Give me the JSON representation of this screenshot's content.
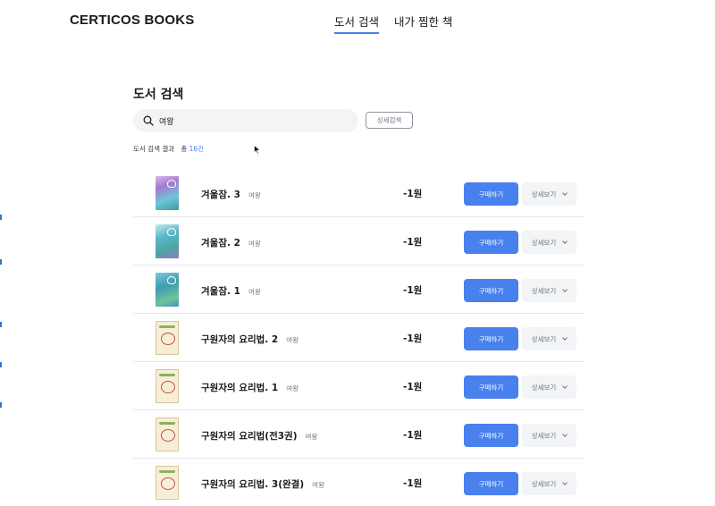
{
  "header": {
    "logo": "CERTICOS BOOKS",
    "nav": [
      {
        "label": "도서 검색",
        "active": true
      },
      {
        "label": "내가 찜한 책",
        "active": false
      }
    ]
  },
  "search": {
    "title": "도서 검색",
    "query": "여왕",
    "detail_button": "상세검색"
  },
  "results": {
    "label": "도서 검색 결과",
    "total_prefix": "총",
    "count": "16",
    "count_suffix": "건"
  },
  "books": [
    {
      "title": "겨울잠. 3",
      "author": "여왕",
      "price": "-1원",
      "cover": "winter-cover-icon"
    },
    {
      "title": "겨울잠. 2",
      "author": "여왕",
      "price": "-1원",
      "cover": "winter-cover-icon"
    },
    {
      "title": "겨울잠. 1",
      "author": "여왕",
      "price": "-1원",
      "cover": "winter-cover-icon"
    },
    {
      "title": "구원자의 요리법. 2",
      "author": "여왕",
      "price": "-1원",
      "cover": "cookbook-cover-icon"
    },
    {
      "title": "구원자의 요리법. 1",
      "author": "여왕",
      "price": "-1원",
      "cover": "cookbook-cover-icon"
    },
    {
      "title": "구원자의 요리법(전3권)",
      "author": "여왕",
      "price": "-1원",
      "cover": "cookbook-cover-icon"
    },
    {
      "title": "구원자의 요리법. 3(완결)",
      "author": "여왕",
      "price": "-1원",
      "cover": "cookbook-cover-icon"
    }
  ],
  "buttons": {
    "buy": "구매하기",
    "detail": "상세보기"
  },
  "colors": {
    "accent": "#4880ee",
    "search_bg": "#f2f4f6",
    "muted_text": "#6d7582"
  }
}
